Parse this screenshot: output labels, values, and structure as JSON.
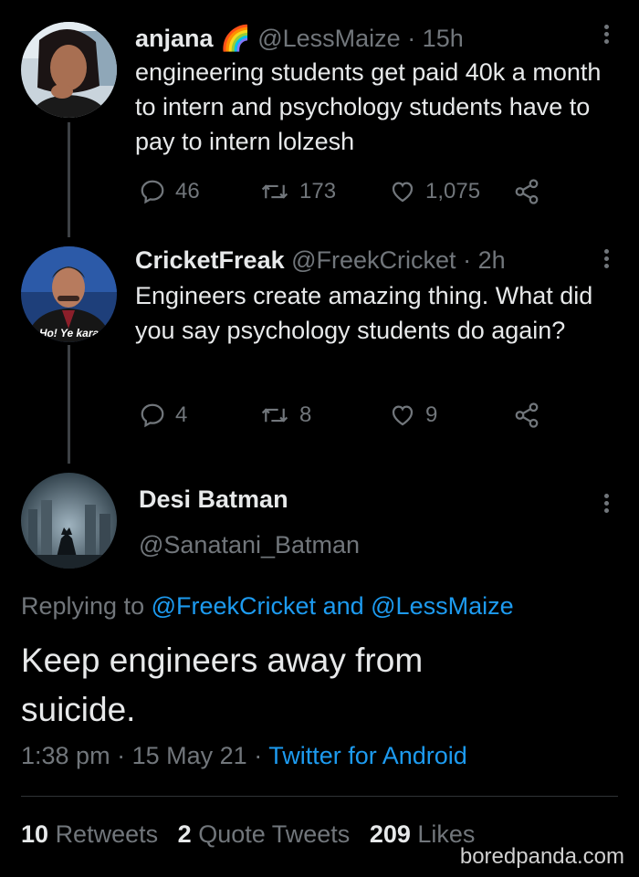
{
  "tweet1": {
    "name": "anjana",
    "emoji": "🌈",
    "handle": "@LessMaize",
    "time": "· 15h",
    "text": "engineering students get paid 40k a month to intern and psychology students have to pay to intern lolzesh",
    "replies": "46",
    "retweets": "173",
    "likes": "1,075"
  },
  "tweet2": {
    "name": "CricketFreak",
    "handle": "@FreekCricket",
    "time": "· 2h",
    "avatar_caption": "Ho! Ye kara",
    "text": "Engineers create amazing thing. What did you say psychology students do again?",
    "replies": "4",
    "retweets": "8",
    "likes": "9"
  },
  "main_tweet": {
    "name": "Desi Batman",
    "handle": "@Sanatani_Batman",
    "replying_prefix": "Replying to",
    "reply_to_1": "@FreekCricket",
    "reply_and": "and",
    "reply_to_2": "@LessMaize",
    "text": "Keep engineers away from suicide.",
    "time": "1:38 pm",
    "date": "15 May 21",
    "sep": "·",
    "client": "Twitter for Android",
    "retweets_count": "10",
    "retweets_label": "Retweets",
    "quotes_count": "2",
    "quotes_label": "Quote Tweets",
    "likes_count": "209",
    "likes_label": "Likes"
  },
  "watermark": "boredpanda.com",
  "colors": {
    "background": "#000000",
    "text": "#e7e9ea",
    "muted": "#71767b",
    "link": "#1d9bf0"
  }
}
